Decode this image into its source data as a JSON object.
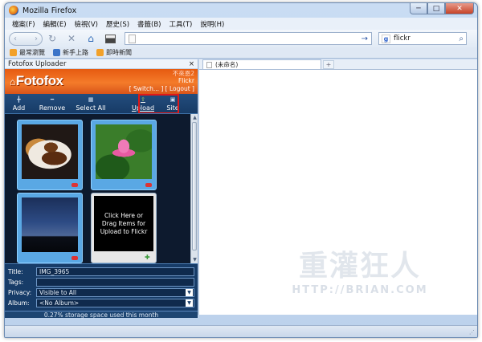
{
  "window": {
    "title": "Mozilla Firefox",
    "minimize": "─",
    "maximize": "□",
    "close": "✕"
  },
  "menu": [
    "檔案(F)",
    "編輯(E)",
    "檢視(V)",
    "歷史(S)",
    "書籤(B)",
    "工具(T)",
    "說明(H)"
  ],
  "nav": {
    "back_icon": "‹",
    "forward_icon": "›",
    "reload_icon": "↻",
    "stop_icon": "✕",
    "home_icon": "⌂",
    "go_icon": "→",
    "url_value": ""
  },
  "search": {
    "engine": "g",
    "value": "flickr",
    "icon": "⌕"
  },
  "bookmarks": [
    "最常瀏覽",
    "新手上路",
    "即時新聞"
  ],
  "sidebar": {
    "title": "Fotofox Uploader",
    "close": "×",
    "logo": "Fotofox",
    "user_line1": "不來恩2",
    "user_line2": "Flickr",
    "links": "[ Switch... ]  [ Logout ]",
    "toolbar": {
      "add": "Add",
      "remove": "Remove",
      "select_all": "Select All",
      "upload": "Upload",
      "site": "Site"
    },
    "drop_text": "Click Here or Drag Items for Upload to Flickr",
    "form": {
      "title_label": "Title:",
      "title_value": "IMG_3965",
      "tags_label": "Tags:",
      "tags_value": "",
      "privacy_label": "Privacy:",
      "privacy_value": "Visible to All",
      "album_label": "Album:",
      "album_value": "<No Album>"
    },
    "storage": "0.27% storage space used this month"
  },
  "tabs": {
    "tab1": "(未命名)",
    "newtab": "+"
  },
  "watermark": {
    "cn": "重灌狂人",
    "en": "HTTP://BRIAN.COM"
  },
  "colors": {
    "accent_orange": "#f47b2a",
    "uploader_blue": "#173c68",
    "highlight_red": "#e01818"
  }
}
